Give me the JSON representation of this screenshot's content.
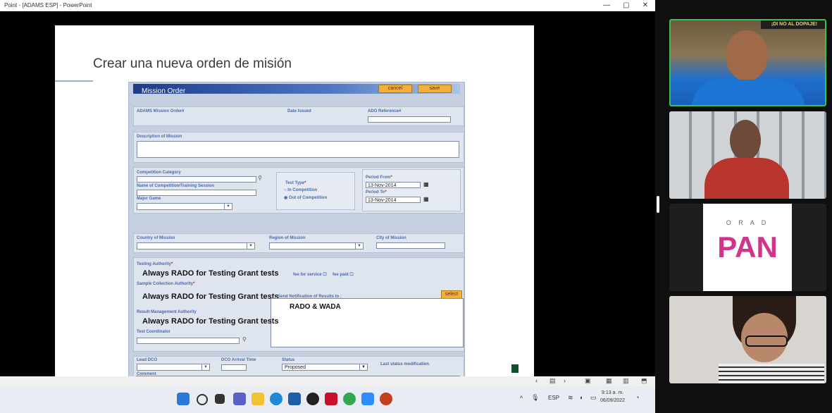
{
  "window": {
    "title": "Point - [ADAMS ESP] - PowerPoint",
    "controls": [
      "—",
      "▢",
      "✕"
    ]
  },
  "slide": {
    "title": "Crear una nueva orden de misión"
  },
  "form": {
    "header": "Mission Order",
    "cancel_label": "cancel",
    "save_label": "save",
    "adams_order_label": "ADAMS Mission Order#",
    "date_issued_label": "Date Issued",
    "ado_reference_label": "ADO Reference#",
    "description_label": "Description of Mission",
    "competition_category_label": "Competition Category",
    "name_of_competition_label": "Name of Competition/Training Session",
    "major_game_label": "Major Game",
    "test_type_label": "Test Type",
    "in_competition_label": "In Competition",
    "out_of_competition_label": "Out of Competition",
    "period_from_label": "Period From",
    "period_from_value": "13-Nov-2014",
    "period_to_label": "Period To",
    "period_to_value": "13-Nov-2014",
    "country_label": "Country of Mission",
    "region_label": "Region of Mission",
    "city_label": "City of Mission",
    "testing_authority_label": "Testing Authority",
    "testing_authority_value": "Always RADO for Testing Grant tests",
    "fee_for_service_label": "fee for service",
    "fee_paid_label": "fee paid",
    "sample_collection_label": "Sample Collection Authority",
    "sample_collection_value": "Always RADO for Testing Grant tests",
    "send_notification_label": "Send Notification of Results to :",
    "select_label": "select",
    "notification_value": "RADO & WADA",
    "result_management_label": "Result Management Authority",
    "result_management_value": "Always RADO for Testing Grant tests",
    "test_coordinator_label": "Test Coordinator",
    "lead_dco_label": "Lead DCO",
    "dco_arrival_label": "DCO Arrival Time",
    "status_label": "Status",
    "status_value": "Proposed",
    "last_status_label": "Last status modification",
    "comment_label": "Comment"
  },
  "taskbar": {
    "language": "ESP",
    "time": "9:13 a. m.",
    "date": "06/09/2022"
  },
  "video_tiles": [
    {
      "name": "participant-1",
      "speaking": true,
      "banner": "¡DI NO AL DOPAJE!"
    },
    {
      "name": "participant-2"
    },
    {
      "name": "participant-3-logo",
      "logo_top": "O R A D",
      "logo_main": "PAN"
    },
    {
      "name": "participant-4"
    }
  ],
  "colors": {
    "form_bg": "#c5cfe0",
    "header_blue": "#1d3c8a",
    "button_orange": "#f0b040",
    "speaker_border": "#3cc04a"
  }
}
